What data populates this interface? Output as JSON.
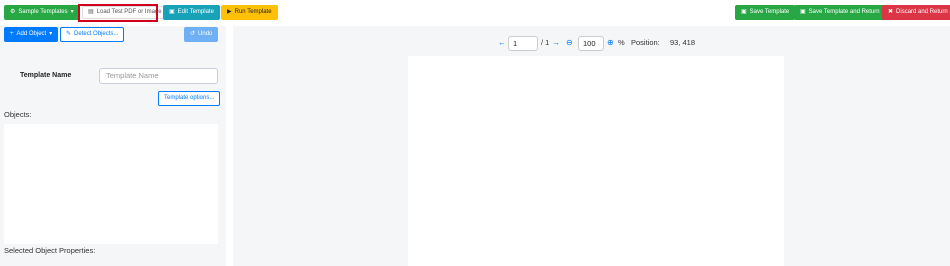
{
  "toolbar": {
    "sample_templates": "Sample Templates",
    "load_test": "Load Test PDF or Image",
    "edit_template": "Edit Template",
    "run_template": "Run Template",
    "save_template": "Save Template",
    "save_return": "Save Template and Return",
    "discard_return": "Discard and Return"
  },
  "left": {
    "add_object": "Add Object",
    "detect_objects": "Detect Objects...",
    "undo": "Undo",
    "template_name_label": "Template Name",
    "template_name_placeholder": "Template Name",
    "template_options": "Template options...",
    "objects_label": "Objects:",
    "selected_props_label": "Selected Object Properties:"
  },
  "viewer": {
    "page_value": "1",
    "page_total": "/ 1",
    "zoom_value": "100",
    "zoom_unit": "%",
    "position_label": "Position:",
    "position_value": "93, 418"
  }
}
